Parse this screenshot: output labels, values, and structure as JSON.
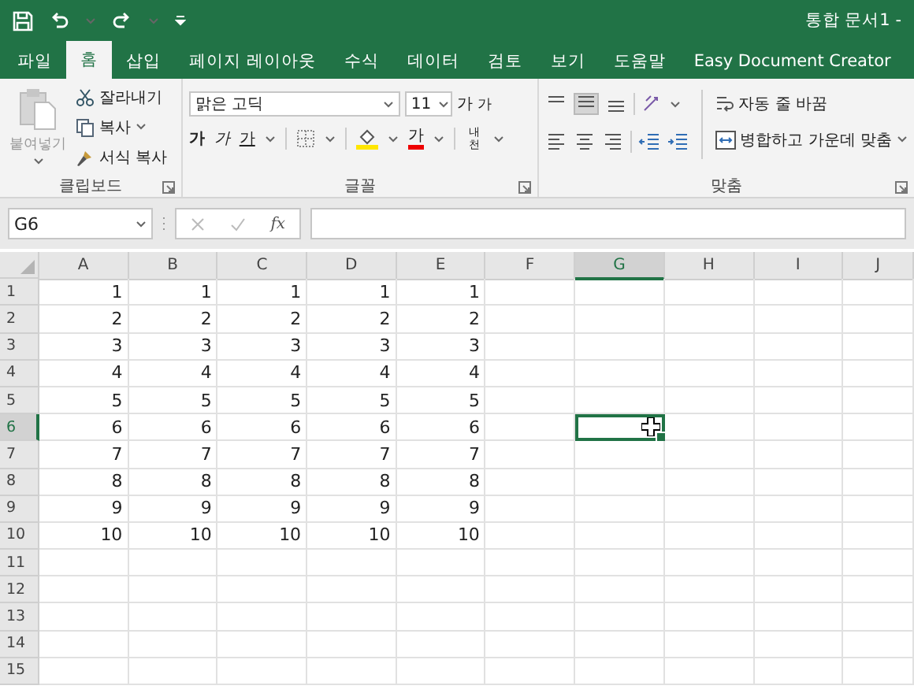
{
  "title_bar": {
    "document_title": "통합 문서1 -"
  },
  "tabs": [
    {
      "label": "파일",
      "selected": false
    },
    {
      "label": "홈",
      "selected": true
    },
    {
      "label": "삽입",
      "selected": false
    },
    {
      "label": "페이지 레이아웃",
      "selected": false
    },
    {
      "label": "수식",
      "selected": false
    },
    {
      "label": "데이터",
      "selected": false
    },
    {
      "label": "검토",
      "selected": false
    },
    {
      "label": "보기",
      "selected": false
    },
    {
      "label": "도움말",
      "selected": false
    },
    {
      "label": "Easy Document Creator",
      "selected": false
    }
  ],
  "ribbon": {
    "clipboard": {
      "paste": "붙여넣기",
      "cut": "잘라내기",
      "copy": "복사",
      "format_painter": "서식 복사",
      "group_label": "클립보드"
    },
    "font": {
      "font_name": "맑은 고딕",
      "font_size": "11",
      "grow": "가",
      "shrink": "가",
      "bold": "가",
      "italic": "가",
      "underline": "가",
      "font_color": "가",
      "phonetic": "내천",
      "group_label": "글꼴"
    },
    "alignment": {
      "wrap_text": "자동 줄 바꿈",
      "merge_center": "병합하고 가운데 맞춤",
      "group_label": "맞춤"
    }
  },
  "formula_bar": {
    "name_box": "G6",
    "function_label": "fx"
  },
  "sheet": {
    "columns": [
      {
        "label": "A",
        "selected": false
      },
      {
        "label": "B",
        "selected": false
      },
      {
        "label": "C",
        "selected": false
      },
      {
        "label": "D",
        "selected": false
      },
      {
        "label": "E",
        "selected": false
      },
      {
        "label": "F",
        "selected": false
      },
      {
        "label": "G",
        "selected": true
      },
      {
        "label": "H",
        "selected": false
      },
      {
        "label": "I",
        "selected": false
      },
      {
        "label": "J",
        "selected": false
      }
    ],
    "rows": [
      {
        "label": "1",
        "selected": false,
        "cells": [
          "1",
          "1",
          "1",
          "1",
          "1"
        ]
      },
      {
        "label": "2",
        "selected": false,
        "cells": [
          "2",
          "2",
          "2",
          "2",
          "2"
        ]
      },
      {
        "label": "3",
        "selected": false,
        "cells": [
          "3",
          "3",
          "3",
          "3",
          "3"
        ]
      },
      {
        "label": "4",
        "selected": false,
        "cells": [
          "4",
          "4",
          "4",
          "4",
          "4"
        ]
      },
      {
        "label": "5",
        "selected": false,
        "cells": [
          "5",
          "5",
          "5",
          "5",
          "5"
        ]
      },
      {
        "label": "6",
        "selected": true,
        "cells": [
          "6",
          "6",
          "6",
          "6",
          "6"
        ]
      },
      {
        "label": "7",
        "selected": false,
        "cells": [
          "7",
          "7",
          "7",
          "7",
          "7"
        ]
      },
      {
        "label": "8",
        "selected": false,
        "cells": [
          "8",
          "8",
          "8",
          "8",
          "8"
        ]
      },
      {
        "label": "9",
        "selected": false,
        "cells": [
          "9",
          "9",
          "9",
          "9",
          "9"
        ]
      },
      {
        "label": "10",
        "selected": false,
        "cells": [
          "10",
          "10",
          "10",
          "10",
          "10"
        ]
      },
      {
        "label": "11",
        "selected": false
      },
      {
        "label": "12",
        "selected": false
      },
      {
        "label": "13",
        "selected": false
      },
      {
        "label": "14",
        "selected": false
      },
      {
        "label": "15",
        "selected": false
      }
    ]
  }
}
